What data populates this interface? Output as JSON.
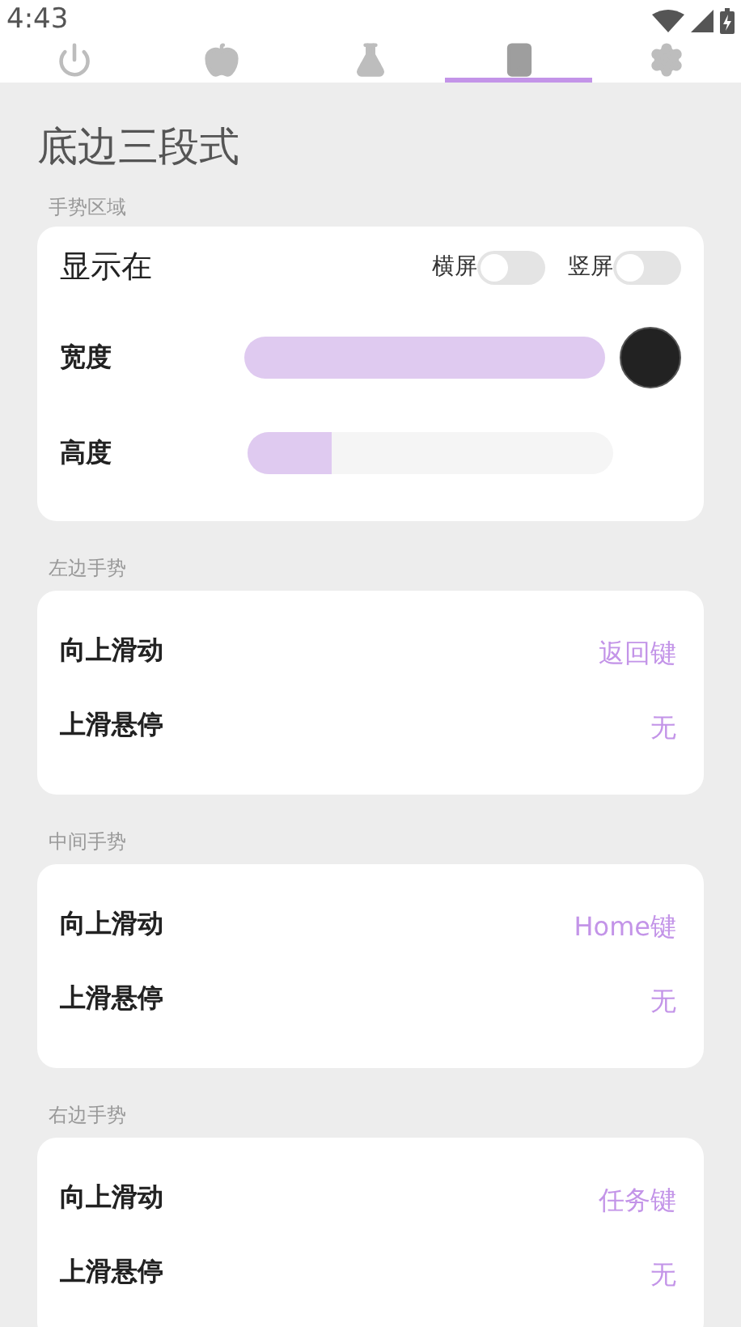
{
  "status_bar": {
    "time": "4:43"
  },
  "tabs": [
    {
      "kind": "power",
      "selected": false
    },
    {
      "kind": "apple",
      "selected": false
    },
    {
      "kind": "flask",
      "selected": false
    },
    {
      "kind": "phone",
      "selected": true
    },
    {
      "kind": "gear",
      "selected": false
    }
  ],
  "title": "底边三段式",
  "gesture_area": {
    "label": "手势区域",
    "show_on": {
      "label": "显示在",
      "toggles": [
        {
          "label": "横屏",
          "on": false
        },
        {
          "label": "竖屏",
          "on": false
        }
      ]
    },
    "sliders": [
      {
        "label": "宽度",
        "level": 1.0
      },
      {
        "label": "高度",
        "level": 0.23
      }
    ]
  },
  "sections": [
    {
      "label": "左边手势",
      "rows": [
        {
          "label": "向上滑动",
          "value": "返回键"
        },
        {
          "label": "上滑悬停",
          "value": "无"
        }
      ]
    },
    {
      "label": "中间手势",
      "rows": [
        {
          "label": "向上滑动",
          "value": "Home键"
        },
        {
          "label": "上滑悬停",
          "value": "无"
        }
      ]
    },
    {
      "label": "右边手势",
      "rows": [
        {
          "label": "向上滑动",
          "value": "任务键"
        },
        {
          "label": "上滑悬停",
          "value": "无"
        }
      ]
    }
  ]
}
